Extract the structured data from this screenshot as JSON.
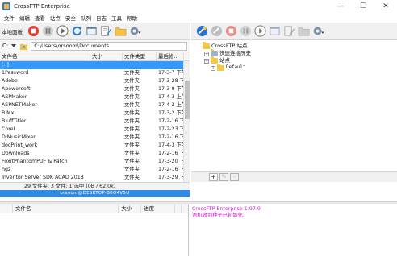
{
  "window": {
    "title": "CrossFTP Enterprise",
    "minimize": "—",
    "maximize": "☐",
    "close": "✕"
  },
  "menu": [
    "文件",
    "编辑",
    "查看",
    "站点",
    "安全",
    "队列",
    "日志",
    "工具",
    "帮助"
  ],
  "left_pane": {
    "toolbar_label": "本地面板",
    "toolbar_icons": [
      "stop-icon",
      "pause-icon",
      "play-icon",
      "refresh-icon",
      "console-icon",
      "edit-icon",
      "new-folder-icon",
      "settings-icon"
    ],
    "path_label": "C:",
    "path": "C:\\Users\\orsoom\\Documents",
    "columns": [
      "文件名",
      "大小",
      "文件类型",
      "最后修..."
    ],
    "rows": [
      {
        "name": "[..]",
        "size": "",
        "type": "",
        "modified": ""
      },
      {
        "name": "1Password",
        "size": "",
        "type": "文件夹",
        "modified": "17-3-7 下午..."
      },
      {
        "name": "Adobe",
        "size": "",
        "type": "文件夹",
        "modified": "17-3-28 下午..."
      },
      {
        "name": "Apowersoft",
        "size": "",
        "type": "文件夹",
        "modified": "17-3-9 下午..."
      },
      {
        "name": "ASPMaker",
        "size": "",
        "type": "文件夹",
        "modified": "17-4-3 上午..."
      },
      {
        "name": "ASPNETMaker",
        "size": "",
        "type": "文件夹",
        "modified": "17-4-3 上午..."
      },
      {
        "name": "BIMx",
        "size": "",
        "type": "文件夹",
        "modified": "17-3-2 下午..."
      },
      {
        "name": "BluffTitler",
        "size": "",
        "type": "文件夹",
        "modified": "17-2-16 下午..."
      },
      {
        "name": "Corel",
        "size": "",
        "type": "文件夹",
        "modified": "17-2-23 下午..."
      },
      {
        "name": "DJMusicMixer",
        "size": "",
        "type": "文件夹",
        "modified": "17-2-16 下午..."
      },
      {
        "name": "docPrint_work",
        "size": "",
        "type": "文件夹",
        "modified": "17-4-3 下午..."
      },
      {
        "name": "Downloads",
        "size": "",
        "type": "文件夹",
        "modified": "17-2-16 下午..."
      },
      {
        "name": "FoxitPhantomPDF & Patch",
        "size": "",
        "type": "文件夹",
        "modified": "17-3-20 上午..."
      },
      {
        "name": "hgz",
        "size": "",
        "type": "文件夹",
        "modified": "17-2-16 下午..."
      },
      {
        "name": "Inventor Server SDK ACAD 2018",
        "size": "",
        "type": "文件夹",
        "modified": "17-3-29 下午..."
      }
    ],
    "status": "29 文件夹, 3 文件: 1 选中 (0B / 62.0k)",
    "host": "orsoom@DESKTOP-B0O4V5U"
  },
  "right_pane": {
    "toolbar_icons": [
      "connect-icon",
      "disconnect-icon",
      "stop-icon",
      "pause-icon",
      "play-icon",
      "console-icon",
      "edit-icon",
      "new-folder-icon",
      "settings-icon"
    ],
    "tree": {
      "root": "CrossFTP 站点",
      "history": "快速连接历史",
      "sites": "站点",
      "default": "Default"
    },
    "buttons": {
      "add": "+",
      "edit": "✎",
      "remove": "–"
    }
  },
  "queue": {
    "columns": [
      "",
      "文件名",
      "大小",
      "进度",
      "",
      ""
    ]
  },
  "log": {
    "lines": [
      "CrossFTP Enterprise 1.97.9",
      "语机收到种子已初始化."
    ]
  }
}
